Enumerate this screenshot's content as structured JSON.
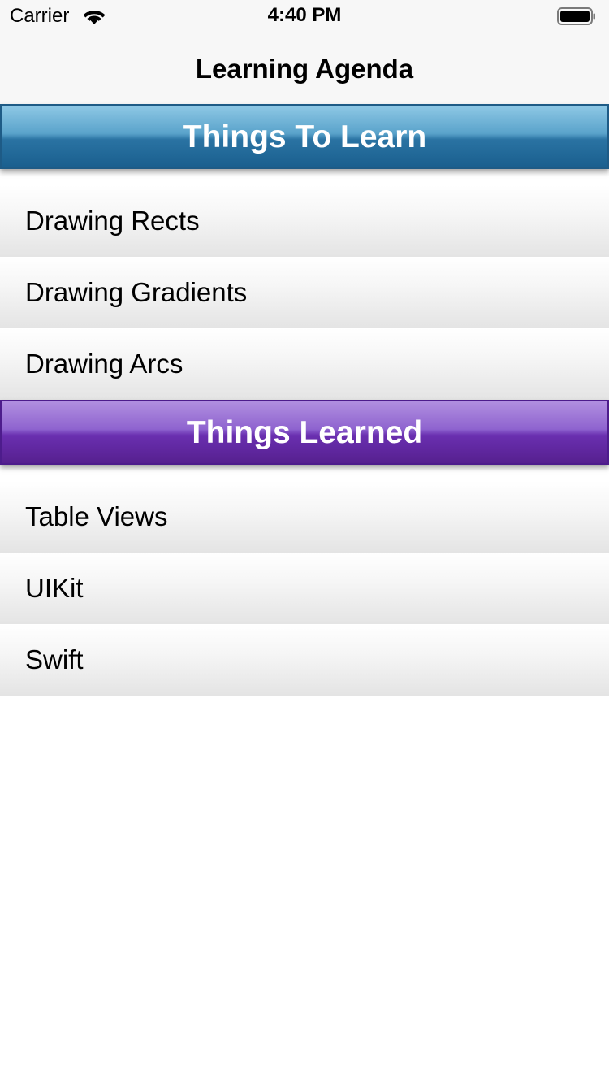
{
  "status_bar": {
    "carrier": "Carrier",
    "time": "4:40 PM",
    "wifi_icon": "wifi-icon",
    "battery_icon": "battery-icon"
  },
  "nav": {
    "title": "Learning Agenda"
  },
  "sections": [
    {
      "title": "Things To Learn",
      "color": "#2a73a3",
      "items": [
        "Drawing Rects",
        "Drawing Gradients",
        "Drawing Arcs"
      ]
    },
    {
      "title": "Things Learned",
      "color": "#6a2fb0",
      "items": [
        "Table Views",
        "UIKit",
        "Swift"
      ]
    }
  ]
}
